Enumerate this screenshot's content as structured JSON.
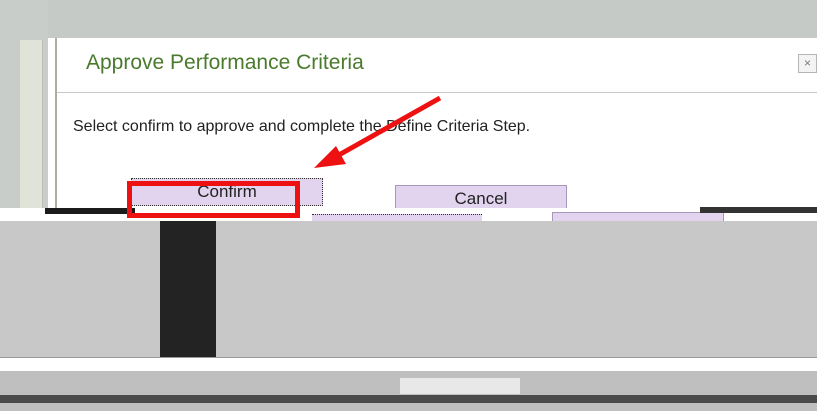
{
  "dialog": {
    "title": "Approve Performance Criteria",
    "close_label": "×",
    "message": "Select confirm to approve and complete the Define Criteria Step."
  },
  "buttons": {
    "confirm_label": "Confirm",
    "cancel_label": "Cancel"
  },
  "colors": {
    "title": "#4a7a2c",
    "button_bg": "#e2d3ef",
    "highlight": "#ee1111"
  }
}
